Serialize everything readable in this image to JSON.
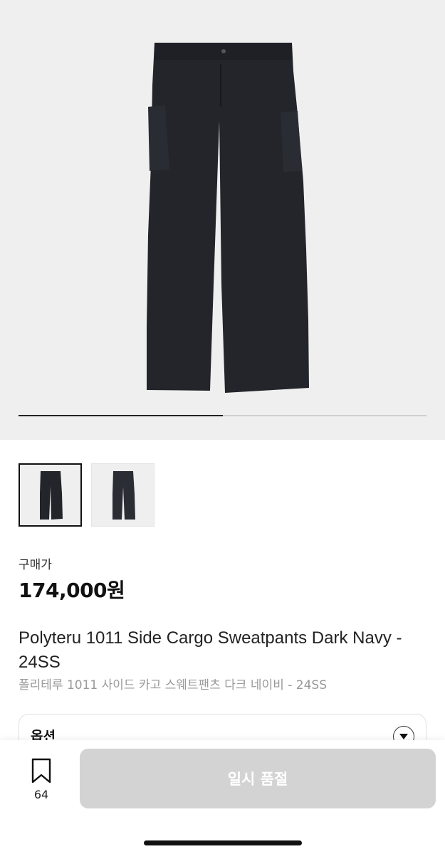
{
  "gallery": {
    "current_image": 1,
    "image_count": 2,
    "progress_fraction": 0.5,
    "thumbnails": [
      {
        "name": "thumbnail-front",
        "selected": true
      },
      {
        "name": "thumbnail-alt",
        "selected": false
      }
    ]
  },
  "product": {
    "price_label": "구매가",
    "price": "174,000원",
    "title_en": "Polyteru 1011 Side Cargo Sweatpants Dark Navy - 24SS",
    "title_ko": "폴리테루 1011 사이드 카고 스웨트팬츠 다크 네이비 - 24SS"
  },
  "options": {
    "label": "옵션"
  },
  "bottom_bar": {
    "bookmark_count": "64",
    "buy_button_label": "일시 품절",
    "buy_button_color": "#d3d3d3"
  },
  "colors": {
    "pants": "#23252b",
    "hero_bg": "#efefef"
  },
  "icons": {
    "bookmark": "bookmark-icon",
    "chevron": "chevron-down-icon"
  }
}
